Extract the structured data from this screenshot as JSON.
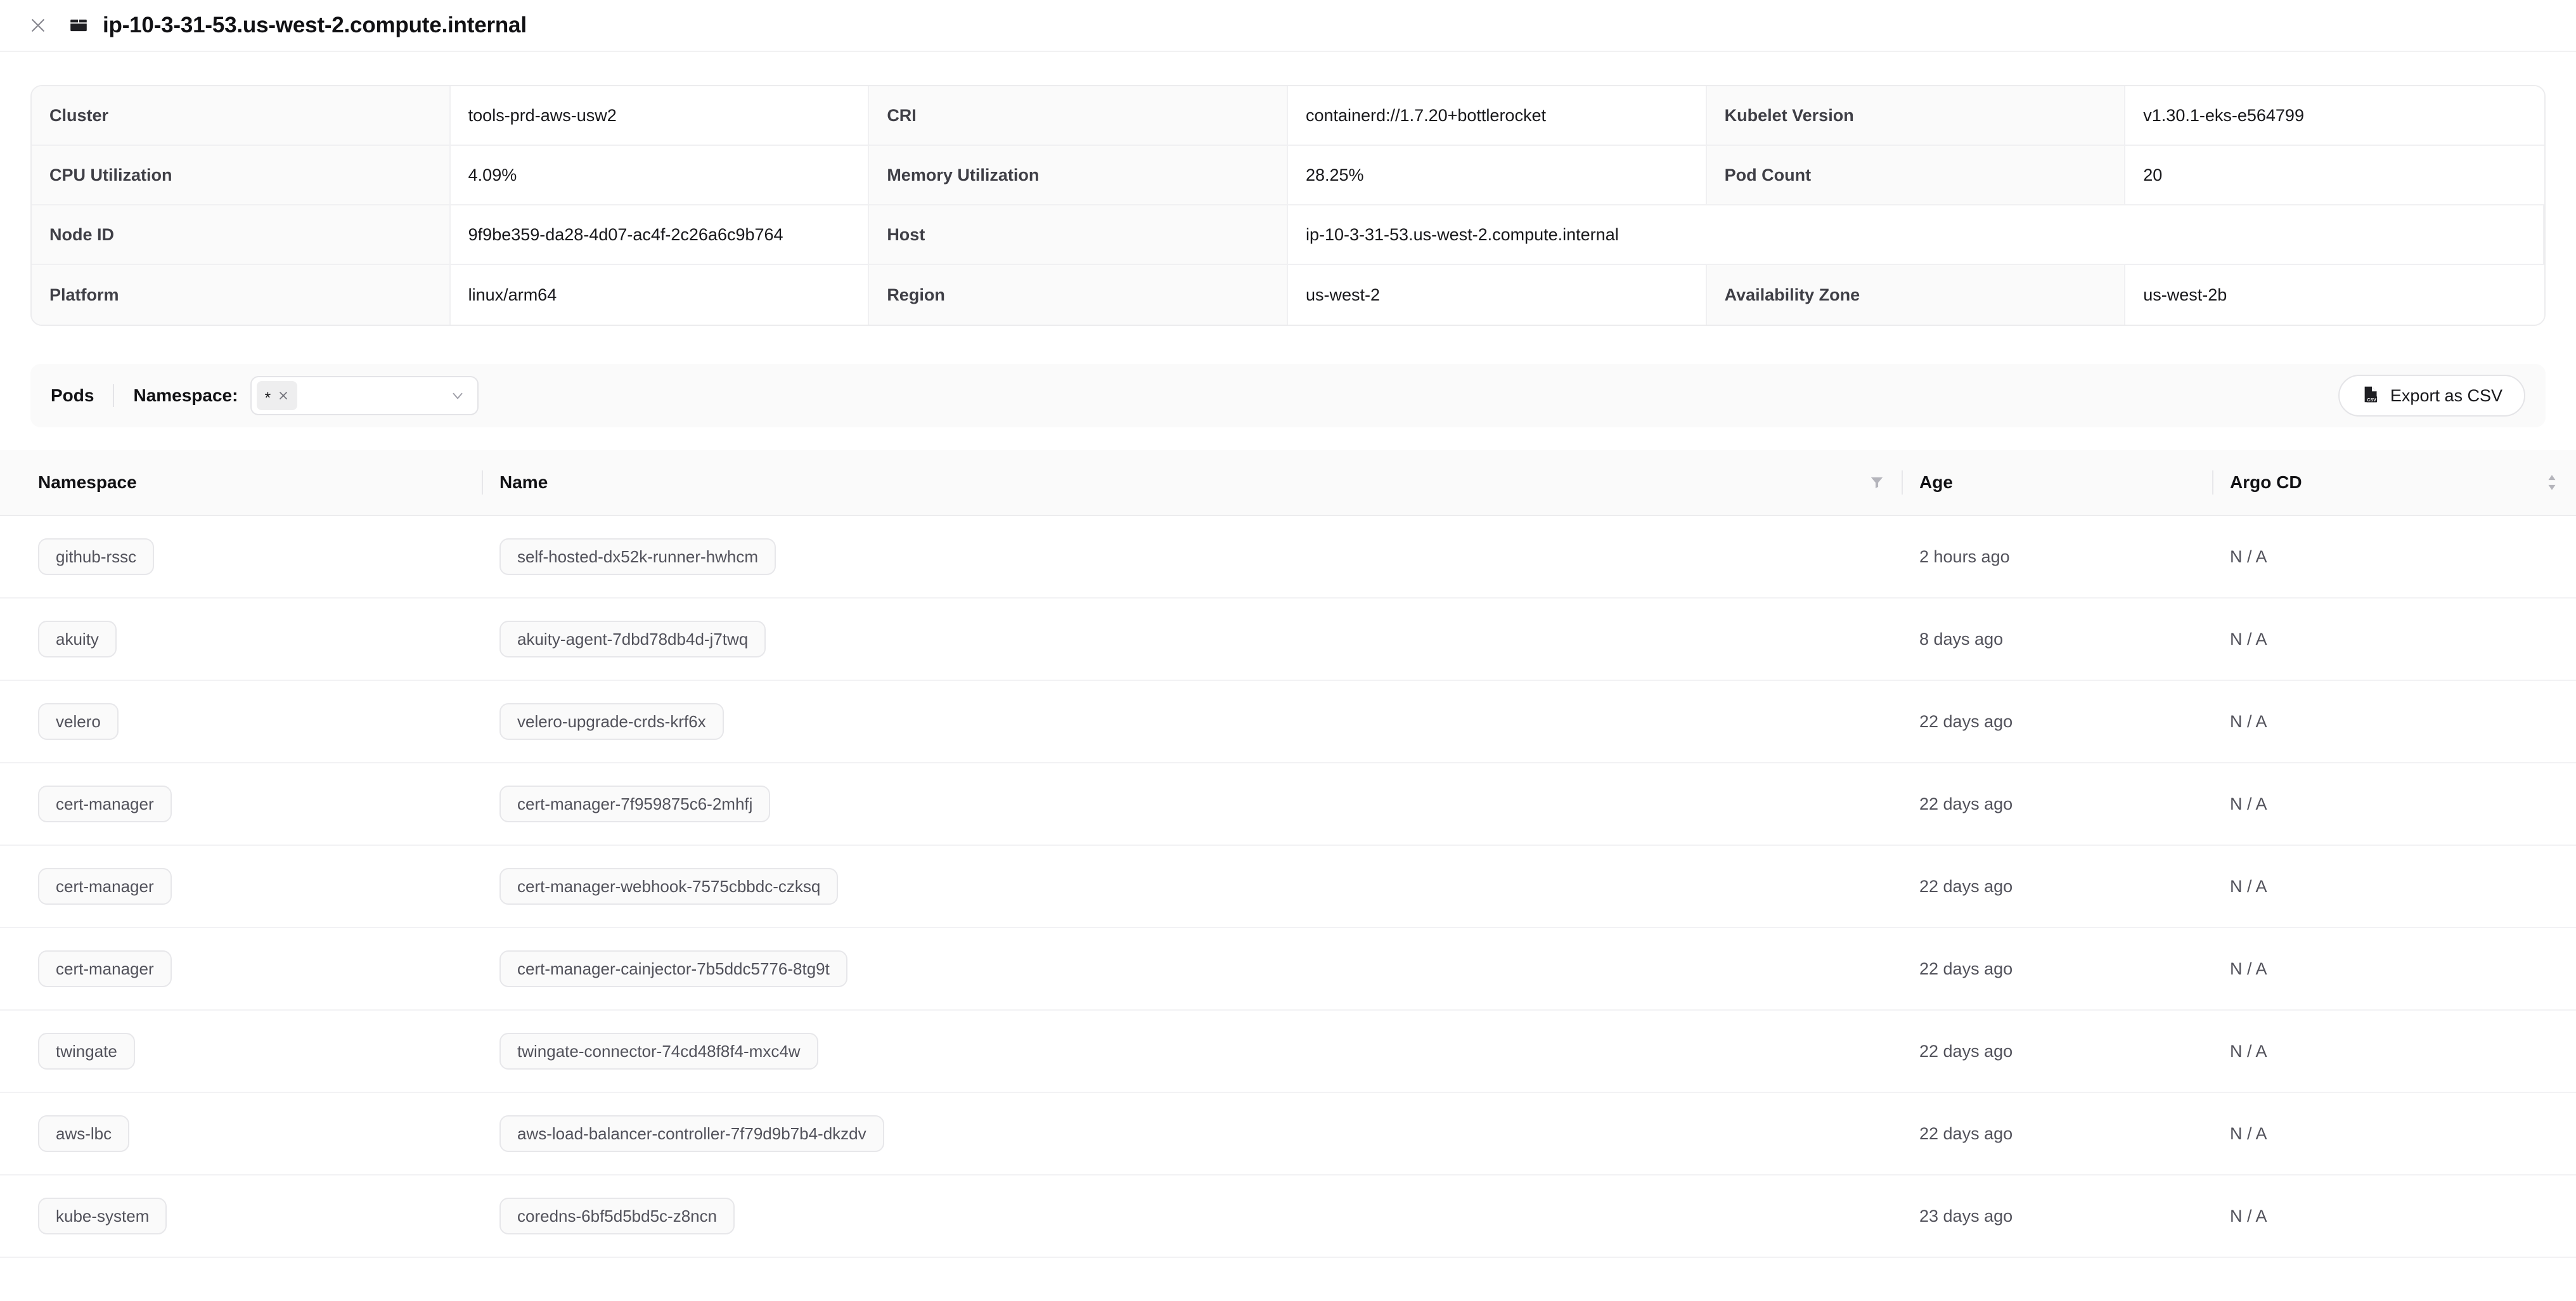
{
  "header": {
    "close_icon": "close-icon",
    "node_icon": "node-box-icon",
    "title": "ip-10-3-31-53.us-west-2.compute.internal"
  },
  "info": {
    "rows": [
      [
        {
          "label": "Cluster",
          "value": "tools-prd-aws-usw2"
        },
        {
          "label": "CRI",
          "value": "containerd://1.7.20+bottlerocket"
        },
        {
          "label": "Kubelet Version",
          "value": "v1.30.1-eks-e564799"
        }
      ],
      [
        {
          "label": "CPU Utilization",
          "value": "4.09%"
        },
        {
          "label": "Memory Utilization",
          "value": "28.25%"
        },
        {
          "label": "Pod Count",
          "value": "20"
        }
      ],
      [
        {
          "label": "Node ID",
          "value": "9f9be359-da28-4d07-ac4f-2c26a6c9b764"
        },
        {
          "label": "Host",
          "value": "ip-10-3-31-53.us-west-2.compute.internal"
        },
        {
          "label": "",
          "value": ""
        }
      ],
      [
        {
          "label": "Platform",
          "value": "linux/arm64"
        },
        {
          "label": "Region",
          "value": "us-west-2"
        },
        {
          "label": "Availability Zone",
          "value": "us-west-2b"
        }
      ]
    ]
  },
  "toolbar": {
    "section_label": "Pods",
    "namespace_label": "Namespace:",
    "namespace_tags": [
      "*"
    ],
    "namespace_remove_icon": "close-icon",
    "namespace_caret_icon": "chevron-down-icon",
    "export_label": "Export as CSV",
    "export_icon": "csv-file-icon"
  },
  "pods_table": {
    "columns": [
      {
        "label": "Namespace",
        "icon": null
      },
      {
        "label": "Name",
        "icon": "filter-icon"
      },
      {
        "label": "Age",
        "icon": null
      },
      {
        "label": "Argo CD",
        "icon": "sort-icon"
      }
    ],
    "rows": [
      {
        "namespace": "github-rssc",
        "name": "self-hosted-dx52k-runner-hwhcm",
        "age": "2 hours ago",
        "argocd": "N / A"
      },
      {
        "namespace": "akuity",
        "name": "akuity-agent-7dbd78db4d-j7twq",
        "age": "8 days ago",
        "argocd": "N / A"
      },
      {
        "namespace": "velero",
        "name": "velero-upgrade-crds-krf6x",
        "age": "22 days ago",
        "argocd": "N / A"
      },
      {
        "namespace": "cert-manager",
        "name": "cert-manager-7f959875c6-2mhfj",
        "age": "22 days ago",
        "argocd": "N / A"
      },
      {
        "namespace": "cert-manager",
        "name": "cert-manager-webhook-7575cbbdc-czksq",
        "age": "22 days ago",
        "argocd": "N / A"
      },
      {
        "namespace": "cert-manager",
        "name": "cert-manager-cainjector-7b5ddc5776-8tg9t",
        "age": "22 days ago",
        "argocd": "N / A"
      },
      {
        "namespace": "twingate",
        "name": "twingate-connector-74cd48f8f4-mxc4w",
        "age": "22 days ago",
        "argocd": "N / A"
      },
      {
        "namespace": "aws-lbc",
        "name": "aws-load-balancer-controller-7f79d9b7b4-dkzdv",
        "age": "22 days ago",
        "argocd": "N / A"
      },
      {
        "namespace": "kube-system",
        "name": "coredns-6bf5d5bd5c-z8ncn",
        "age": "23 days ago",
        "argocd": "N / A"
      }
    ]
  },
  "colors": {
    "page_bg": "#ffffff",
    "panel_bg": "#fafafa",
    "border": "#ececee",
    "text": "#18181b",
    "muted_text": "#52525b"
  }
}
